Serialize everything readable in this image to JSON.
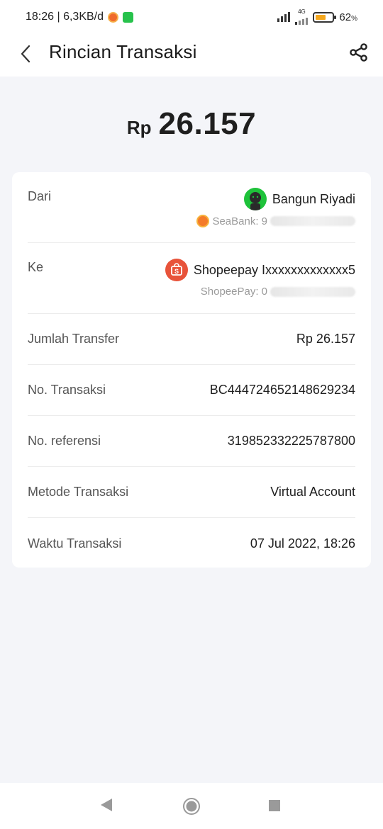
{
  "status_bar": {
    "time_speed": "18:26 | 6,3KB/d",
    "network_label": "4G",
    "battery_percent": "62",
    "battery_unit": "%",
    "battery_level": 0.62
  },
  "header": {
    "title": "Rincian Transaksi"
  },
  "amount": {
    "currency": "Rp",
    "value": "26.157"
  },
  "from": {
    "label": "Dari",
    "name": "Bangun Riyadi",
    "sub_prefix": "SeaBank: 9"
  },
  "to": {
    "label": "Ke",
    "name": "Shopeepay Ixxxxxxxxxxxxx5",
    "sub_prefix": "ShopeePay: 0"
  },
  "details": [
    {
      "label": "Jumlah Transfer",
      "value": "Rp 26.157"
    },
    {
      "label": "No. Transaksi",
      "value": "BC444724652148629234"
    },
    {
      "label": "No. referensi",
      "value": "319852332225787800"
    },
    {
      "label": "Metode Transaksi",
      "value": "Virtual Account"
    },
    {
      "label": "Waktu Transaksi",
      "value": "07 Jul 2022, 18:26"
    }
  ],
  "colors": {
    "background": "#f4f5f9",
    "shopee_orange": "#e8533a",
    "avatar_green": "#1ec23a",
    "battery_fill": "#f4a71e"
  },
  "icons": [
    "back-arrow-icon",
    "share-icon",
    "seabank-icon",
    "shopee-icon",
    "avatar-icon",
    "nav-back-icon",
    "nav-home-icon",
    "nav-recents-icon"
  ]
}
